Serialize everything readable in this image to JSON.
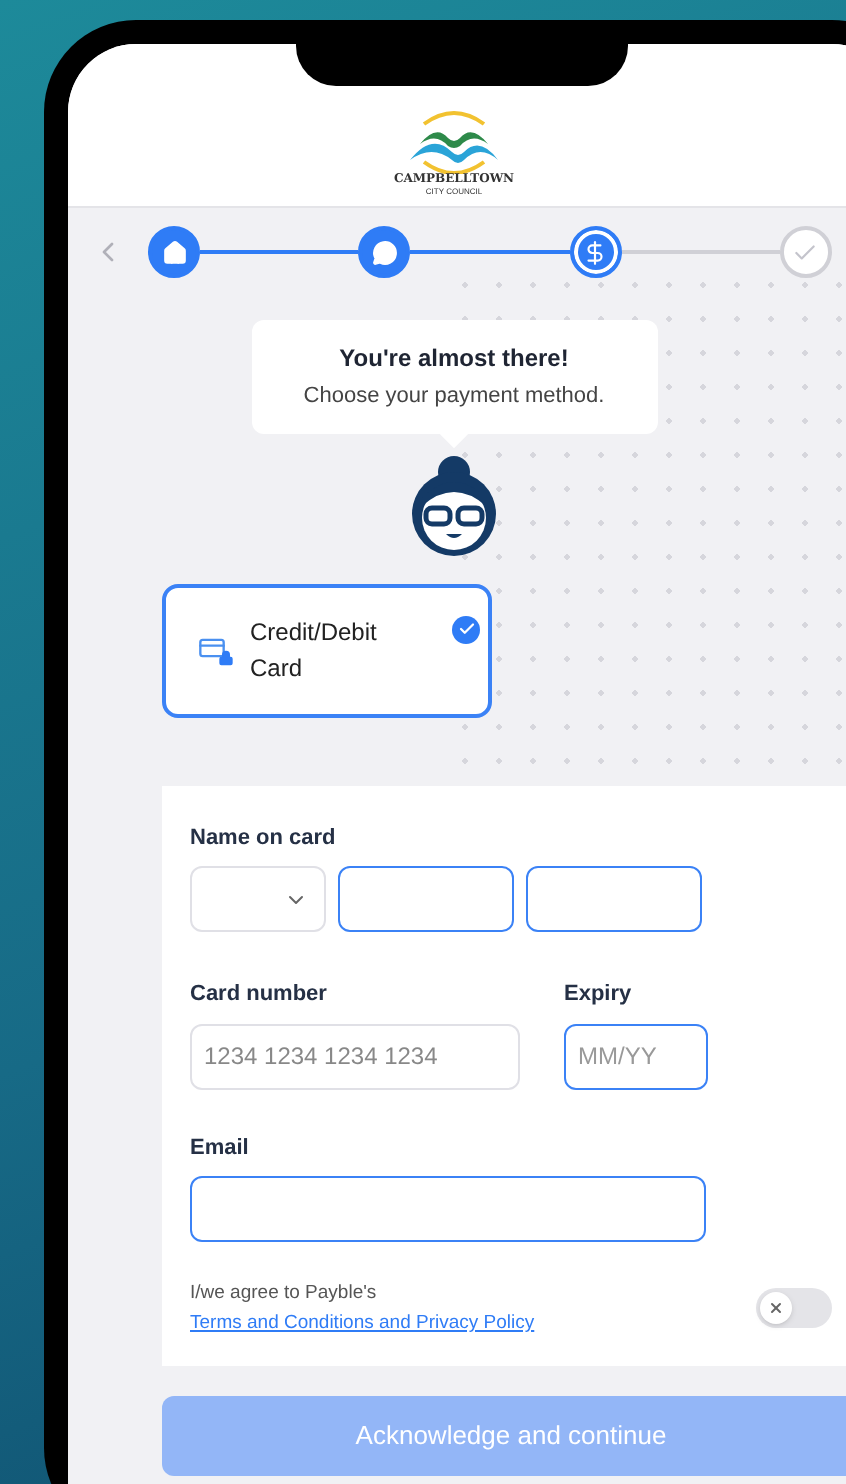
{
  "header": {
    "logo_name": "CAMPBELLTOWN",
    "logo_subtitle": "CITY COUNCIL"
  },
  "stepper": {
    "steps": [
      {
        "kind": "home",
        "done": true,
        "selected": false
      },
      {
        "kind": "chat",
        "done": true,
        "selected": false
      },
      {
        "kind": "dollar",
        "done": false,
        "selected": true
      },
      {
        "kind": "check",
        "done": false,
        "selected": false
      }
    ]
  },
  "tooltip": {
    "title": "You're almost there!",
    "message": "Choose your payment method."
  },
  "payment_methods": [
    {
      "label": "Credit/Debit Card",
      "selected": true
    }
  ],
  "form": {
    "name_label": "Name on card",
    "card_label": "Card number",
    "card_placeholder": "1234 1234 1234 1234",
    "expiry_label": "Expiry",
    "expiry_placeholder": "MM/YY",
    "email_label": "Email",
    "agreement": {
      "text": "I/we agree to Payble's",
      "link": "Terms and Conditions and Privacy Policy",
      "on": false
    }
  },
  "submit_button": {
    "label": "Acknowledge and continue",
    "disabled": true
  }
}
